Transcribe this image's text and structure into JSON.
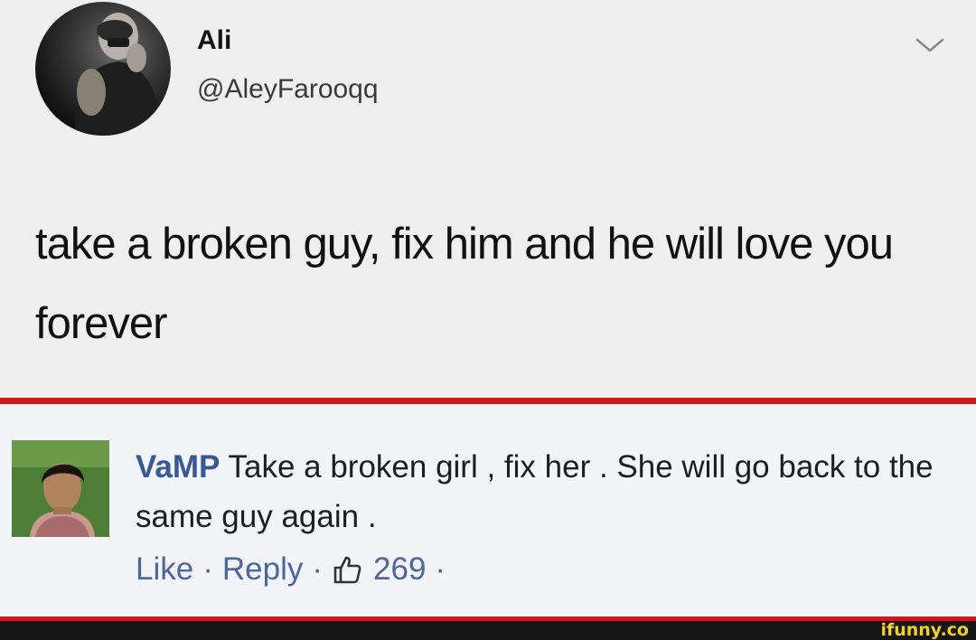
{
  "tweet": {
    "name": "Ali",
    "handle": "@AleyFarooqq",
    "text": "take a broken guy, fix him and he will love you forever",
    "menu_icon": "chevron-down-icon"
  },
  "comment": {
    "author": "VaMP",
    "text": " Take a broken girl , fix her . She will go back to the same guy again .",
    "actions": {
      "like_label": "Like",
      "separator": "·",
      "reply_label": "Reply",
      "like_count": "269"
    },
    "like_icon": "thumbs-up-icon"
  },
  "watermark": {
    "text": "ifunny.co"
  },
  "colors": {
    "divider": "#d7141a",
    "author_link": "#385898",
    "action_link": "#4b67a1",
    "watermark": "#f2d21c"
  }
}
